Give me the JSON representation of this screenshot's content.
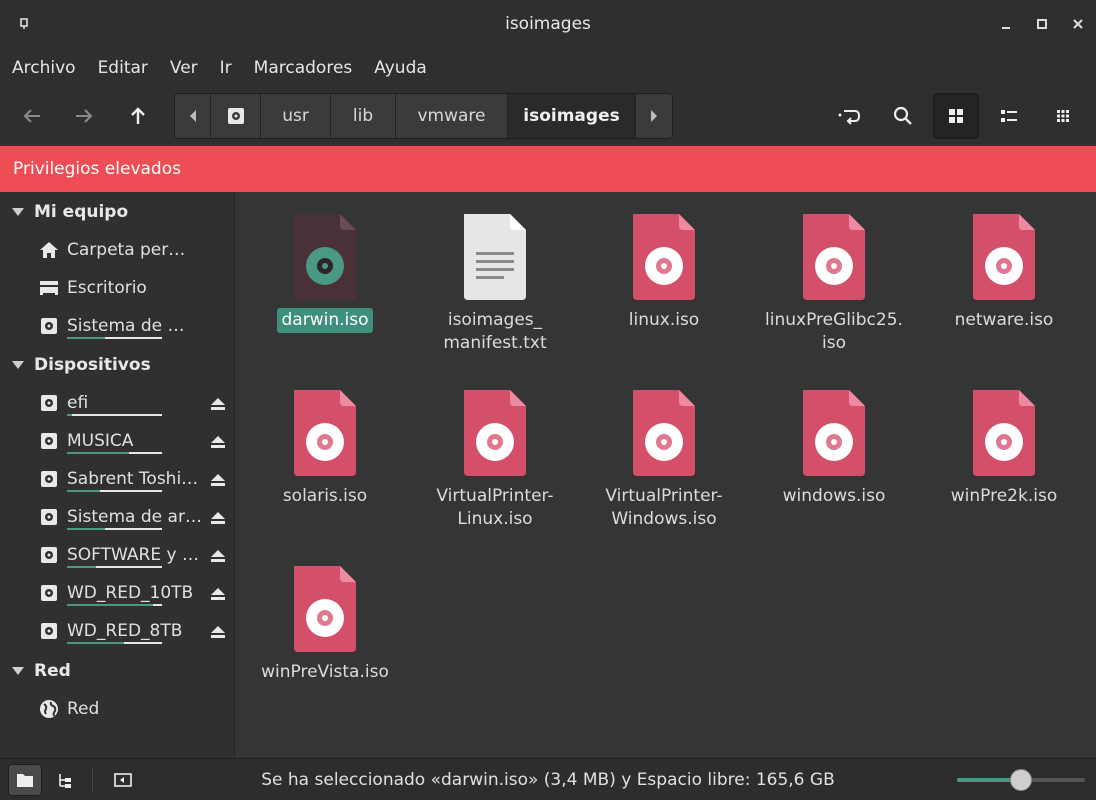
{
  "window": {
    "title": "isoimages"
  },
  "menu": [
    "Archivo",
    "Editar",
    "Ver",
    "Ir",
    "Marcadores",
    "Ayuda"
  ],
  "pathbar": {
    "segments": [
      "usr",
      "lib",
      "vmware",
      "isoimages"
    ],
    "active": "isoimages"
  },
  "banner": {
    "text": "Privilegios elevados",
    "color": "#ee4d55"
  },
  "sidebar": {
    "sections": [
      {
        "label": "Mi equipo",
        "items": [
          {
            "label": "Carpeta pers…",
            "icon": "home-icon"
          },
          {
            "label": "Escritorio",
            "icon": "desktop-icon"
          },
          {
            "label": "Sistema de ar…",
            "icon": "drive-icon",
            "usage": 0.4
          }
        ]
      },
      {
        "label": "Dispositivos",
        "items": [
          {
            "label": "efi",
            "icon": "drive-icon",
            "usage": 0.05,
            "eject": true
          },
          {
            "label": "MUSICA",
            "icon": "drive-icon",
            "usage": 0.65,
            "eject": true
          },
          {
            "label": "Sabrent Toshi…",
            "icon": "drive-icon",
            "usage": 0.35,
            "eject": true
          },
          {
            "label": "Sistema de ar…",
            "icon": "drive-icon",
            "usage": 0.4,
            "eject": true
          },
          {
            "label": "SOFTWARE y …",
            "icon": "drive-icon",
            "usage": 0.3,
            "eject": true
          },
          {
            "label": "WD_RED_10TB",
            "icon": "drive-icon",
            "usage": 0.9,
            "eject": true
          },
          {
            "label": "WD_RED_8TB",
            "icon": "drive-icon",
            "usage": 0.6,
            "eject": true
          }
        ]
      },
      {
        "label": "Red",
        "items": [
          {
            "label": "Red",
            "icon": "network-icon"
          }
        ]
      }
    ]
  },
  "files": [
    {
      "name": "darwin.iso",
      "type": "iso-dark",
      "selected": true
    },
    {
      "name": "isoimages_\nmanifest.txt",
      "type": "text"
    },
    {
      "name": "linux.iso",
      "type": "iso"
    },
    {
      "name": "linuxPreGlibc25.\niso",
      "type": "iso"
    },
    {
      "name": "netware.iso",
      "type": "iso"
    },
    {
      "name": "solaris.iso",
      "type": "iso"
    },
    {
      "name": "VirtualPrinter-\nLinux.iso",
      "type": "iso"
    },
    {
      "name": "VirtualPrinter-\nWindows.iso",
      "type": "iso"
    },
    {
      "name": "windows.iso",
      "type": "iso"
    },
    {
      "name": "winPre2k.iso",
      "type": "iso"
    },
    {
      "name": "winPreVista.iso",
      "type": "iso"
    }
  ],
  "status": {
    "text": "Se ha seleccionado «darwin.iso» (3,4 MB) y Espacio libre: 165,6 GB",
    "zoom_level": 0.5
  },
  "colors": {
    "accent": "#4a9985",
    "iso": "#d4506a",
    "iso_fold": "#ee8aa0",
    "iso_dark": "#4a3138"
  }
}
